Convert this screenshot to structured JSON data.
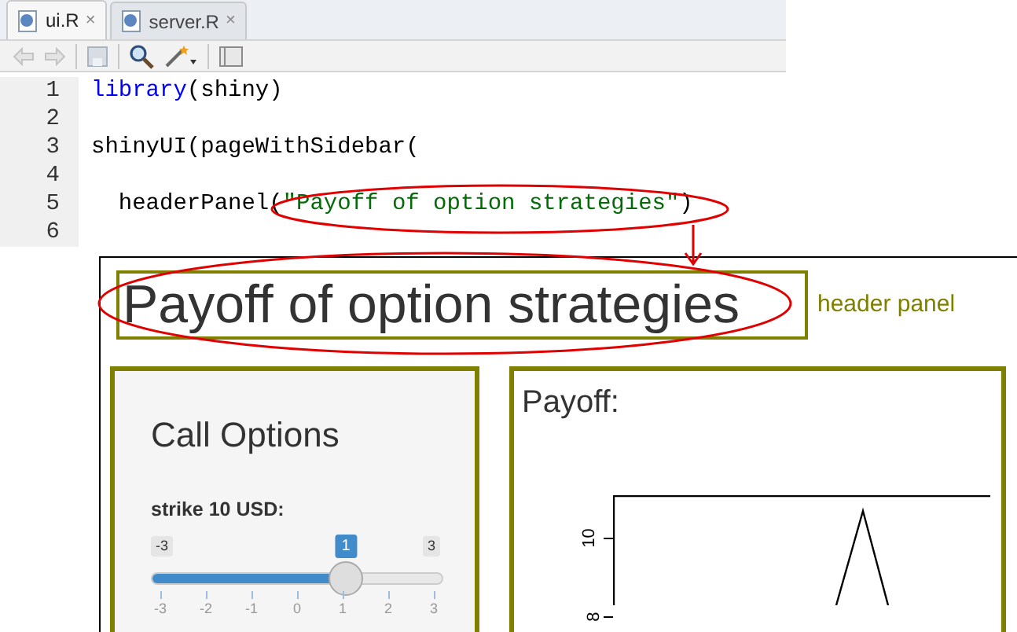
{
  "editor": {
    "tabs": [
      {
        "label": "ui.R",
        "selected": true,
        "close": "×"
      },
      {
        "label": "server.R",
        "selected": false,
        "close": "×"
      }
    ],
    "lines": [
      {
        "number": "1",
        "tokens": [
          {
            "kind": "fn",
            "text": "library"
          },
          {
            "kind": "plain",
            "text": "(shiny)"
          }
        ]
      },
      {
        "number": "2"
      },
      {
        "number": "3",
        "tokens": [
          {
            "kind": "plain",
            "text": "shinyUI(pageWithSidebar("
          }
        ]
      },
      {
        "number": "4"
      },
      {
        "number": "5",
        "tokens": [
          {
            "kind": "plain",
            "text": "  headerPanel("
          },
          {
            "kind": "string",
            "text": "\"Payoff of option strategies\""
          },
          {
            "kind": "plain",
            "text": ")"
          }
        ]
      },
      {
        "number": "6"
      }
    ]
  },
  "app": {
    "header": {
      "title": "Payoff of option strategies"
    },
    "annotation": "header panel",
    "sidebar": {
      "title": "Call Options",
      "slider": {
        "label": "strike 10 USD:",
        "min": "-3",
        "max": "3",
        "value": "1",
        "level": 0.667,
        "ticks": [
          "-3",
          "-2",
          "-1",
          "0",
          "1",
          "2",
          "3"
        ]
      }
    },
    "main": {
      "title": "Payoff:",
      "plot": {
        "yticks": [
          "10",
          "8"
        ]
      }
    }
  }
}
